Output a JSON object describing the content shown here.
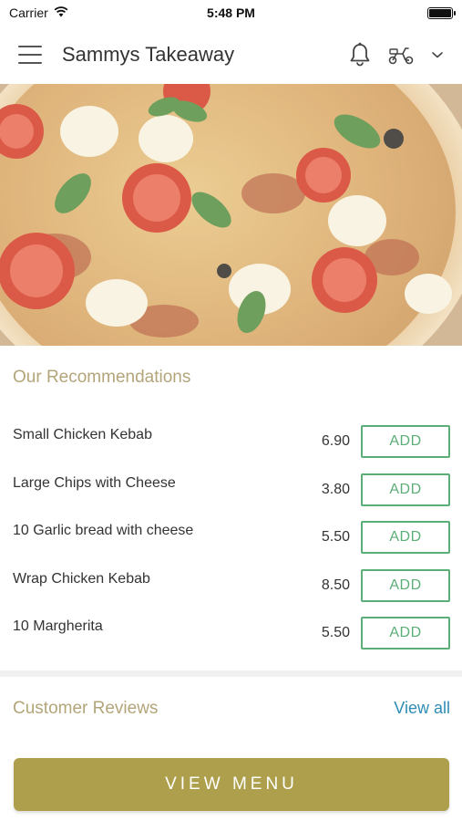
{
  "status_bar": {
    "carrier": "Carrier",
    "time": "5:48 PM"
  },
  "header": {
    "title": "Sammys Takeaway",
    "icons": [
      "menu-icon",
      "bell-icon",
      "delivery-scooter-icon",
      "chevron-down-icon"
    ]
  },
  "hero": {
    "image": "pizza-photo"
  },
  "recommendations": {
    "title": "Our Recommendations",
    "items": [
      {
        "name": "Small Chicken Kebab",
        "price": "6.90",
        "button": "ADD"
      },
      {
        "name": "Large Chips with Cheese",
        "price": "3.80",
        "button": "ADD"
      },
      {
        "name": "10 Garlic bread with cheese",
        "price": "5.50",
        "button": "ADD"
      },
      {
        "name": "Wrap Chicken Kebab",
        "price": "8.50",
        "button": "ADD"
      },
      {
        "name": "10 Margherita",
        "price": "5.50",
        "button": "ADD"
      }
    ]
  },
  "reviews": {
    "title": "Customer Reviews",
    "view_all": "View all"
  },
  "footer": {
    "view_menu": "VIEW MENU"
  },
  "colors": {
    "accent_gold": "#ae9f4c",
    "section_title": "#b3a57a",
    "add_green": "#5cae78",
    "link_blue": "#2f8cb5"
  }
}
